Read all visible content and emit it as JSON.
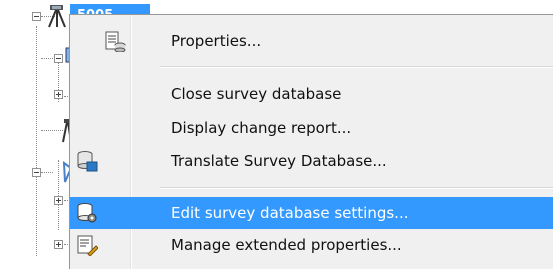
{
  "tree": {
    "selected_node_label": "5005..."
  },
  "context_menu": {
    "items": [
      {
        "label": "Properties...",
        "icon": "properties-icon"
      },
      {
        "label": "Close survey database",
        "icon": ""
      },
      {
        "label": "Display change report...",
        "icon": ""
      },
      {
        "label": "Translate Survey Database...",
        "icon": "translate-database-icon"
      },
      {
        "label": "Edit survey database settings...",
        "icon": "database-settings-icon",
        "highlighted": true
      },
      {
        "label": "Manage extended properties...",
        "icon": "extended-properties-icon"
      }
    ]
  },
  "colors": {
    "selection": "#3399ff",
    "menu_background": "#f0f0f0"
  }
}
